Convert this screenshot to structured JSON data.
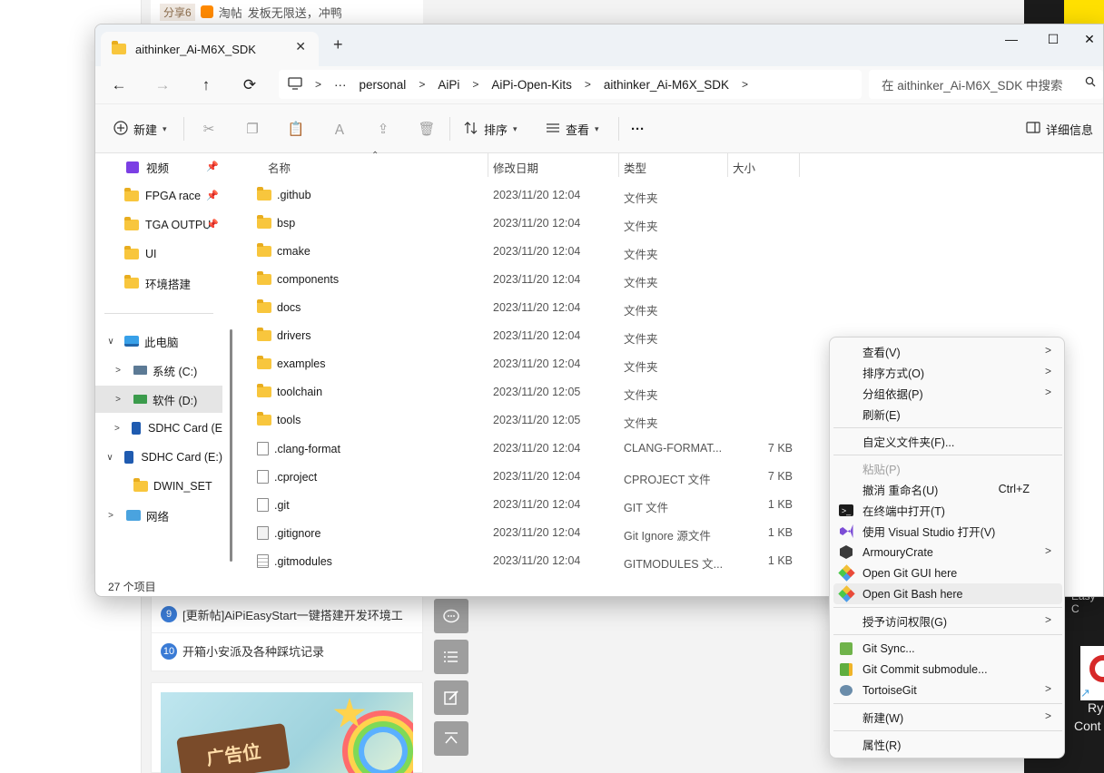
{
  "background": {
    "top_row": {
      "share_label": "分享6",
      "taobao_label": "淘帖",
      "text": "发板无限送，冲鸭"
    },
    "list_items": [
      {
        "number": "9",
        "text": "[更新帖]AiPiEasyStart一键搭建开发环境工"
      },
      {
        "number": "10",
        "text": "开箱小安派及各种踩坑记录"
      }
    ],
    "ad_text": "广告位",
    "right_panel": {
      "easy_text": "Easy C",
      "ry_text": "Ry",
      "cont_text": "Cont"
    }
  },
  "window": {
    "tab_title": "aithinker_Ai-M6X_SDK",
    "tab_close": "✕",
    "new_tab": "+",
    "controls": {
      "minimize": "—",
      "maximize": "☐",
      "close": "✕"
    }
  },
  "address": {
    "back": "←",
    "forward": "→",
    "up": "↑",
    "refresh": "⟳",
    "overflow": "···",
    "crumbs": [
      "personal",
      "AiPi",
      "AiPi-Open-Kits",
      "aithinker_Ai-M6X_SDK"
    ],
    "search_placeholder": "在 aithinker_Ai-M6X_SDK 中搜索"
  },
  "toolbar": {
    "new_label": "新建",
    "sort_label": "排序",
    "view_label": "查看",
    "more_label": "···",
    "details_label": "详细信息"
  },
  "sidebar": {
    "items": [
      {
        "label": "视频",
        "icon": "video-icon",
        "pinned": true
      },
      {
        "label": "FPGA race",
        "icon": "folder-icon",
        "pinned": true
      },
      {
        "label": "TGA OUTPU",
        "icon": "folder-icon",
        "pinned": true
      },
      {
        "label": "UI",
        "icon": "folder-icon",
        "pinned": false
      },
      {
        "label": "环境搭建",
        "icon": "folder-icon",
        "pinned": false
      },
      {
        "label": "此电脑",
        "icon": "computer-icon",
        "expanded": true
      },
      {
        "label": "系统 (C:)",
        "icon": "drive-icon",
        "expanded": false
      },
      {
        "label": "软件 (D:)",
        "icon": "drive-icon",
        "expanded": false,
        "selected": true
      },
      {
        "label": "SDHC Card (E",
        "icon": "sd-card-icon",
        "expanded": false
      },
      {
        "label": "SDHC Card (E:)",
        "icon": "sd-card-icon",
        "expanded": true
      },
      {
        "label": "DWIN_SET",
        "icon": "folder-icon"
      },
      {
        "label": "网络",
        "icon": "network-icon",
        "expanded": false
      }
    ]
  },
  "columns": {
    "name": "名称",
    "modified": "修改日期",
    "type": "类型",
    "size": "大小"
  },
  "files": [
    {
      "name": ".github",
      "modified": "2023/11/20 12:04",
      "type": "文件夹",
      "size": "",
      "kind": "folder"
    },
    {
      "name": "bsp",
      "modified": "2023/11/20 12:04",
      "type": "文件夹",
      "size": "",
      "kind": "folder"
    },
    {
      "name": "cmake",
      "modified": "2023/11/20 12:04",
      "type": "文件夹",
      "size": "",
      "kind": "folder"
    },
    {
      "name": "components",
      "modified": "2023/11/20 12:04",
      "type": "文件夹",
      "size": "",
      "kind": "folder"
    },
    {
      "name": "docs",
      "modified": "2023/11/20 12:04",
      "type": "文件夹",
      "size": "",
      "kind": "folder"
    },
    {
      "name": "drivers",
      "modified": "2023/11/20 12:04",
      "type": "文件夹",
      "size": "",
      "kind": "folder"
    },
    {
      "name": "examples",
      "modified": "2023/11/20 12:04",
      "type": "文件夹",
      "size": "",
      "kind": "folder"
    },
    {
      "name": "toolchain",
      "modified": "2023/11/20 12:05",
      "type": "文件夹",
      "size": "",
      "kind": "folder"
    },
    {
      "name": "tools",
      "modified": "2023/11/20 12:05",
      "type": "文件夹",
      "size": "",
      "kind": "folder"
    },
    {
      "name": ".clang-format",
      "modified": "2023/11/20 12:04",
      "type": "CLANG-FORMAT...",
      "size": "7 KB",
      "kind": "file"
    },
    {
      "name": ".cproject",
      "modified": "2023/11/20 12:04",
      "type": "CPROJECT 文件",
      "size": "7 KB",
      "kind": "file"
    },
    {
      "name": ".git",
      "modified": "2023/11/20 12:04",
      "type": "GIT 文件",
      "size": "1 KB",
      "kind": "file"
    },
    {
      "name": ".gitignore",
      "modified": "2023/11/20 12:04",
      "type": "Git Ignore 源文件",
      "size": "1 KB",
      "kind": "gear"
    },
    {
      "name": ".gitmodules",
      "modified": "2023/11/20 12:04",
      "type": "GITMODULES 文...",
      "size": "1 KB",
      "kind": "lines"
    }
  ],
  "status": {
    "item_count": "27 个项目"
  },
  "context_menu": {
    "items": [
      {
        "label": "查看(V)",
        "submenu": true
      },
      {
        "label": "排序方式(O)",
        "submenu": true
      },
      {
        "label": "分组依据(P)",
        "submenu": true
      },
      {
        "label": "刷新(E)"
      },
      {
        "sep": true
      },
      {
        "label": "自定义文件夹(F)..."
      },
      {
        "sep": true
      },
      {
        "label": "粘贴(P)",
        "disabled": true
      },
      {
        "label": "撤消 重命名(U)",
        "shortcut": "Ctrl+Z"
      },
      {
        "label": "在终端中打开(T)",
        "icon": "terminal-icon"
      },
      {
        "label": "使用 Visual Studio 打开(V)",
        "icon": "visual-studio-icon"
      },
      {
        "label": "ArmouryCrate",
        "icon": "armoury-crate-icon",
        "submenu": true
      },
      {
        "label": "Open Git GUI here",
        "icon": "git-gui-icon"
      },
      {
        "label": "Open Git Bash here",
        "icon": "git-bash-icon",
        "hover": true
      },
      {
        "sep": true
      },
      {
        "label": "授予访问权限(G)",
        "submenu": true
      },
      {
        "sep": true
      },
      {
        "label": "Git Sync...",
        "icon": "git-sync-icon"
      },
      {
        "label": "Git Commit submodule...",
        "icon": "git-commit-icon"
      },
      {
        "label": "TortoiseGit",
        "icon": "tortoisegit-icon",
        "submenu": true
      },
      {
        "sep": true
      },
      {
        "label": "新建(W)",
        "submenu": true
      },
      {
        "sep": true
      },
      {
        "label": "属性(R)"
      }
    ]
  }
}
